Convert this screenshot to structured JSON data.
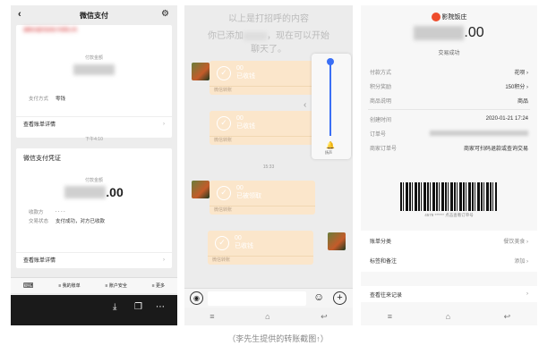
{
  "left": {
    "title": "微信支付",
    "merchant": "湖南天盛讯信电子有限公司",
    "amount_label": "付款金额",
    "pay_method_label": "支付方式",
    "pay_method_value": "零钱",
    "view_detail": "查看账单详情",
    "time": "下午4:10",
    "voucher_title": "微信支付凭证",
    "voucher_amount_label": "付款金额",
    "voucher_amount": ".00",
    "payee_label": "收款方",
    "payee_value": ". . . .",
    "status_label": "交易状态",
    "status_value": "支付成功，对方已收款",
    "view_detail2": "查看账单详情",
    "bottom_tabs": [
      "我的账单",
      "账户安全",
      "更多"
    ]
  },
  "middle": {
    "system_msg1": "以上是打招呼的内容",
    "system_msg2": "你已添加",
    "system_msg2b": "，现在可以开始",
    "system_msg3": "聊天了。",
    "transfers": [
      {
        "amount": "00",
        "status": "已收钱",
        "label": "微信转账"
      },
      {
        "amount": "00",
        "status": "已收钱",
        "label": "微信转账"
      },
      {
        "amount": "00",
        "status": "已被领取",
        "label": "微信转账"
      },
      {
        "amount": "00",
        "status": "已收钱",
        "label": "微信转账"
      }
    ],
    "time": "15:33",
    "slider_label": "扬声"
  },
  "right": {
    "shop_name": "影院饭庄",
    "amount": ".00",
    "trade_status": "交易成功",
    "rows": [
      {
        "k": "付款方式",
        "v": "花呗"
      },
      {
        "k": "积分奖励",
        "v": "150积分"
      },
      {
        "k": "商品说明",
        "v": "商品"
      }
    ],
    "create_time_label": "创建时间",
    "create_time_value": "2020-01-21 17:24",
    "order_no_label": "订单号",
    "merchant_order_label": "商家订单号",
    "merchant_order_value": "商家可扫码退款或查询交易",
    "barcode_text": "4579 ****** 点击查看订单号",
    "category_label": "账单分类",
    "category_value": "餐饮美食",
    "tags_label": "标签和备注",
    "tags_value": "添加",
    "history_label": "查看往来记录"
  },
  "caption": "（李先生提供的转账截图↑）"
}
